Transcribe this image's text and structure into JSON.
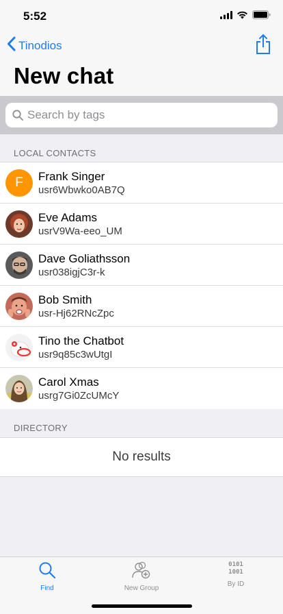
{
  "status": {
    "time": "5:52"
  },
  "nav": {
    "back_label": "Tinodios",
    "title": "New chat"
  },
  "search": {
    "placeholder": "Search by tags",
    "value": ""
  },
  "sections": {
    "local_contacts": "LOCAL CONTACTS",
    "directory": "DIRECTORY"
  },
  "contacts": [
    {
      "name": "Frank Singer",
      "id": "usr6Wbwko0AB7Q",
      "initial": "F",
      "avatar": "letter-avatar"
    },
    {
      "name": "Eve Adams",
      "id": "usrV9Wa-eeo_UM",
      "avatar": "photo-avatar-eve"
    },
    {
      "name": "Dave Goliathsson",
      "id": "usr038igjC3r-k",
      "avatar": "photo-avatar-dave"
    },
    {
      "name": "Bob Smith",
      "id": "usr-Hj62RNcZpc",
      "avatar": "photo-avatar-bob"
    },
    {
      "name": "Tino the Chatbot",
      "id": "usr9q85c3wUtgI",
      "avatar": "photo-avatar-tino"
    },
    {
      "name": "Carol Xmas",
      "id": "usrg7Gi0ZcUMcY",
      "avatar": "photo-avatar-carol"
    }
  ],
  "directory": {
    "empty_text": "No results"
  },
  "tabs": [
    {
      "label": "Find",
      "icon": "search-icon",
      "active": true
    },
    {
      "label": "New Group",
      "icon": "group-add-icon",
      "active": false
    },
    {
      "label": "By ID",
      "icon": "binary-icon",
      "icon_text_1": "0101",
      "icon_text_2": "1001",
      "active": false
    }
  ],
  "colors": {
    "accent": "#1e7cf2",
    "avatar_letter_bg": "#ff9500",
    "background": "#efeff4"
  }
}
